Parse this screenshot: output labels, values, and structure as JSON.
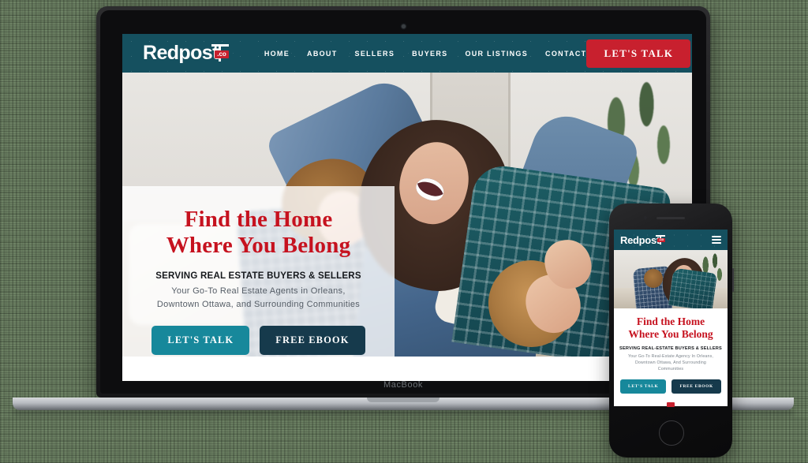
{
  "device_labels": {
    "laptop": "MacBook"
  },
  "colors": {
    "nav_bg": "#15505f",
    "brand_red": "#c8202e",
    "headline_red": "#c6121f",
    "teal_button": "#17889b",
    "navy_button": "#163a4c",
    "backdrop_green": "#6d8264"
  },
  "site": {
    "logo": {
      "word": "Redpost",
      "badge": ".co"
    },
    "nav": {
      "items": [
        {
          "label": "HOME"
        },
        {
          "label": "ABOUT"
        },
        {
          "label": "SELLERS"
        },
        {
          "label": "BUYERS"
        },
        {
          "label": "OUR LISTINGS"
        },
        {
          "label": "CONTACT"
        }
      ],
      "cta_label": "LET'S TALK"
    },
    "hero": {
      "title_line1": "Find the Home",
      "title_line2": "Where You Belong",
      "subheading": "SERVING REAL ESTATE BUYERS & SELLERS",
      "description_line1": "Your Go-To Real Estate Agents in Orleans,",
      "description_line2": "Downtown Ottawa, and Surrounding Communities",
      "primary_button": "LET'S TALK",
      "secondary_button": "FREE EBOOK"
    }
  },
  "mobile_site": {
    "logo": {
      "word": "Redpost",
      "badge": ".co"
    },
    "menu_icon": "hamburger-menu-icon",
    "hero": {
      "title_line1": "Find the Home",
      "title_line2": "Where You Belong",
      "subheading": "SERVING REAL-ESTATE BUYERS & SELLERS",
      "description_line1": "Your Go-To Real-Estate Agency In Orleans,",
      "description_line2": "Downtown Ottawa, And Surrounding",
      "description_line3": "Communities",
      "primary_button": "LET'S TALK",
      "secondary_button": "FREE EBOOK"
    }
  }
}
